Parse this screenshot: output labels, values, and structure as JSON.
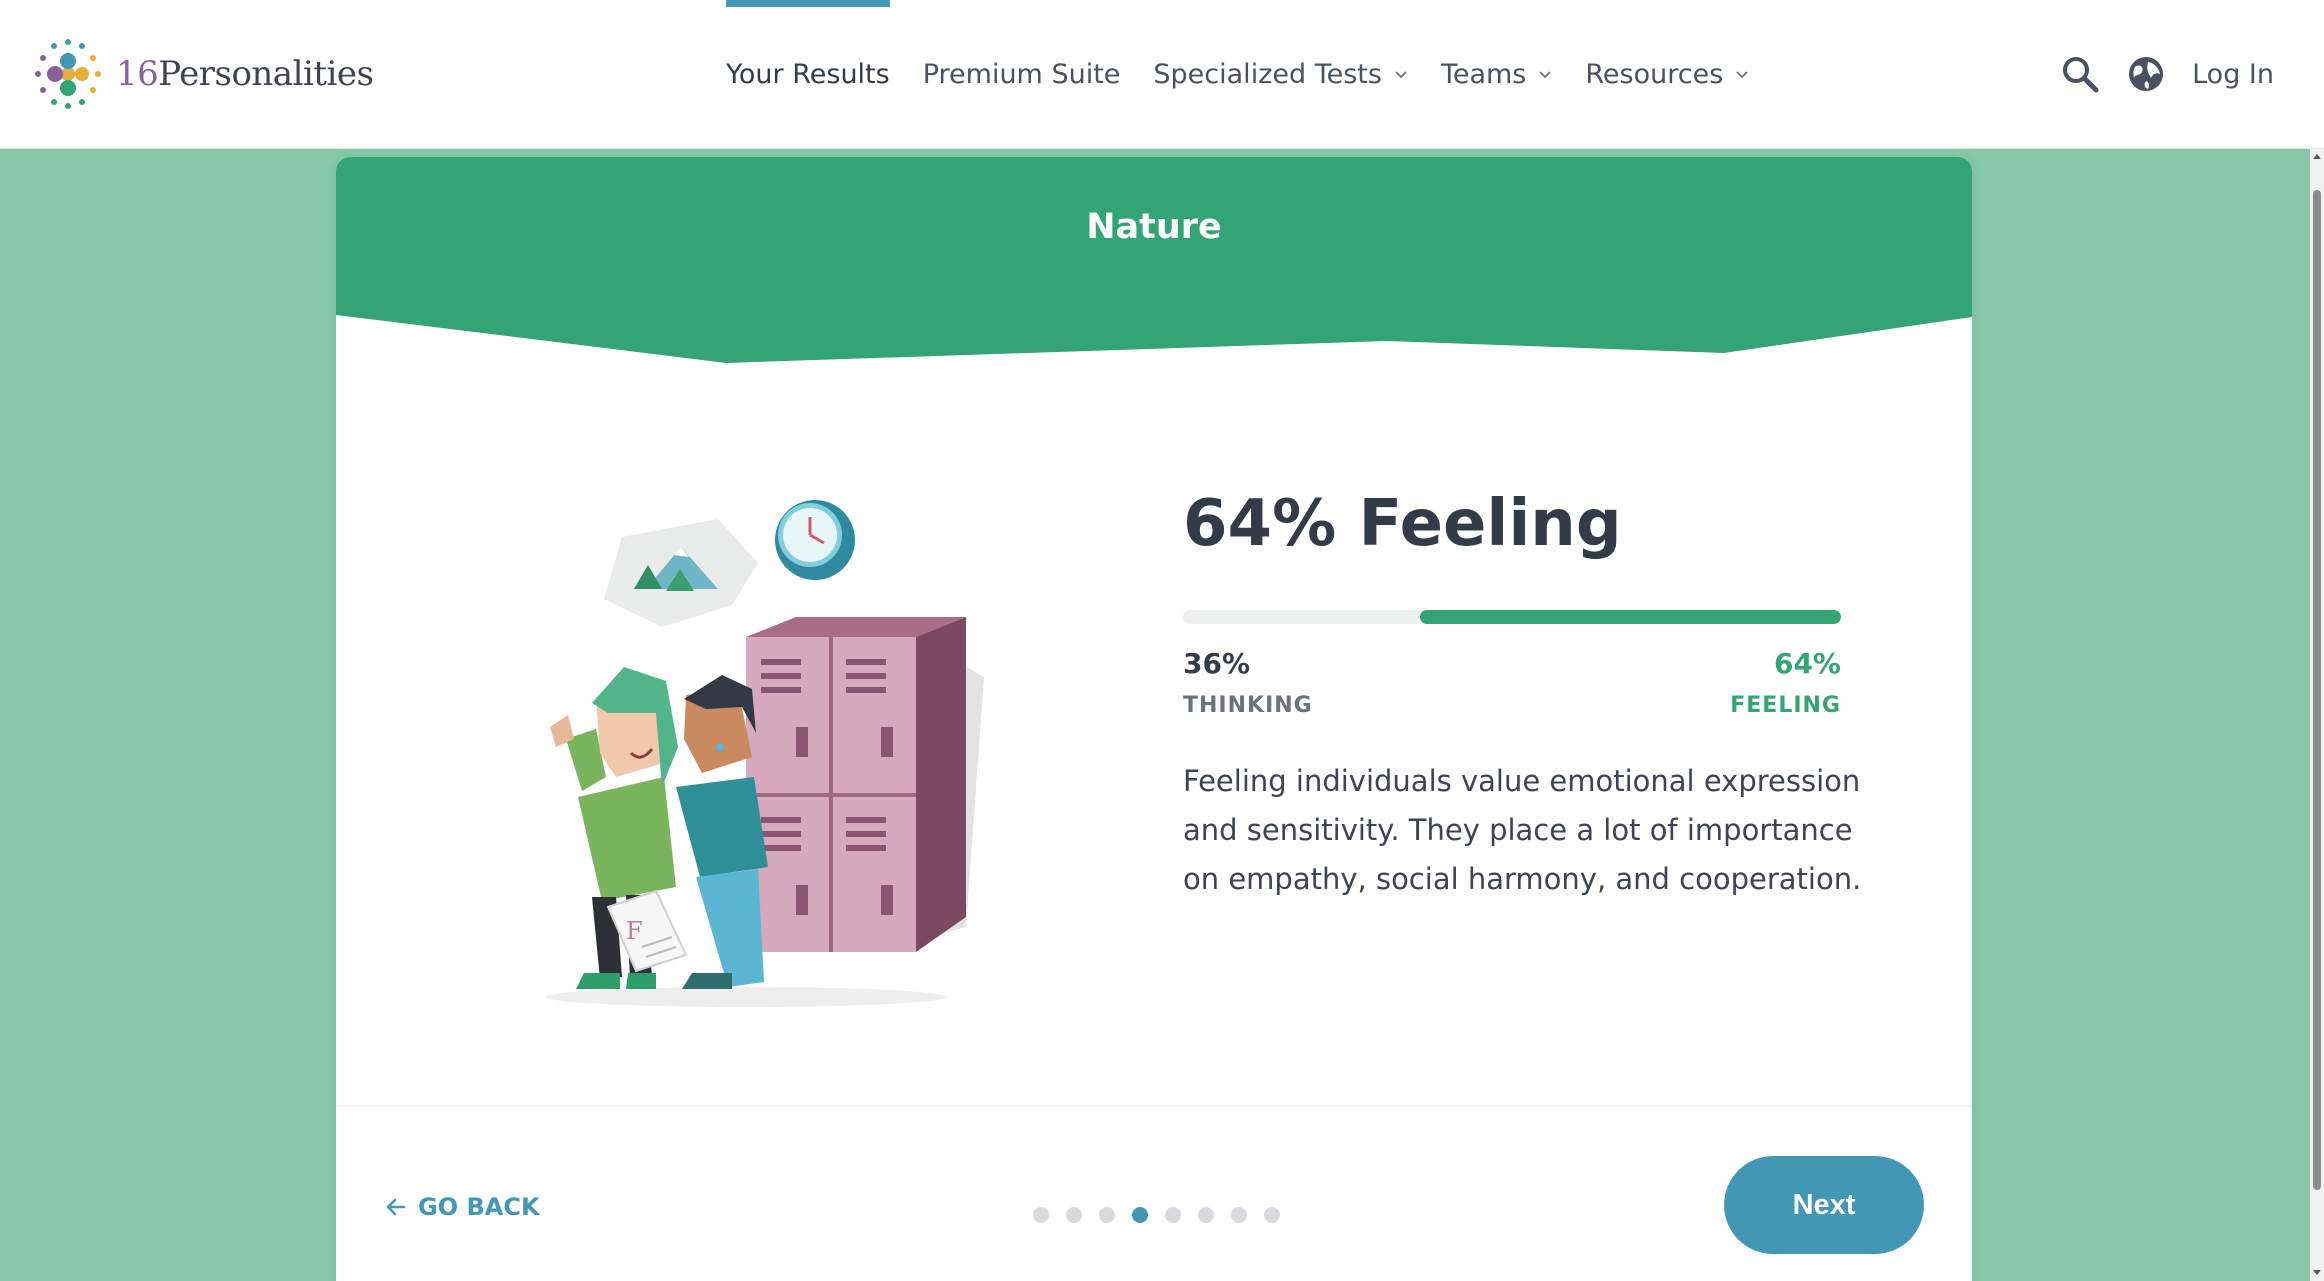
{
  "brand": {
    "logo_number": "16",
    "logo_word": "Personalities"
  },
  "nav": {
    "items": [
      {
        "label": "Your Results",
        "active": true,
        "dropdown": false
      },
      {
        "label": "Premium Suite",
        "active": false,
        "dropdown": false
      },
      {
        "label": "Specialized Tests",
        "active": false,
        "dropdown": true
      },
      {
        "label": "Teams",
        "active": false,
        "dropdown": true
      },
      {
        "label": "Resources",
        "active": false,
        "dropdown": true
      }
    ],
    "login": "Log In",
    "icons": [
      "search-icon",
      "globe-icon"
    ]
  },
  "card": {
    "title": "Nature",
    "headline": "64% Feeling",
    "left_trait": {
      "percent": "36%",
      "name": "THINKING"
    },
    "right_trait": {
      "percent": "64%",
      "name": "FEELING"
    },
    "progress_fraction": 0.64,
    "description": "Feeling individuals value emotional expression and sensitivity. They place a lot of importance on empathy, social harmony, and cooperation."
  },
  "footer": {
    "back_label": "GO BACK",
    "next_label": "Next",
    "pagination": {
      "total": 8,
      "current": 4
    }
  },
  "colors": {
    "accent": "#33a474",
    "blue": "#4298b4",
    "page_bg": "#86c7a9",
    "logo_purple": "#88619a"
  }
}
